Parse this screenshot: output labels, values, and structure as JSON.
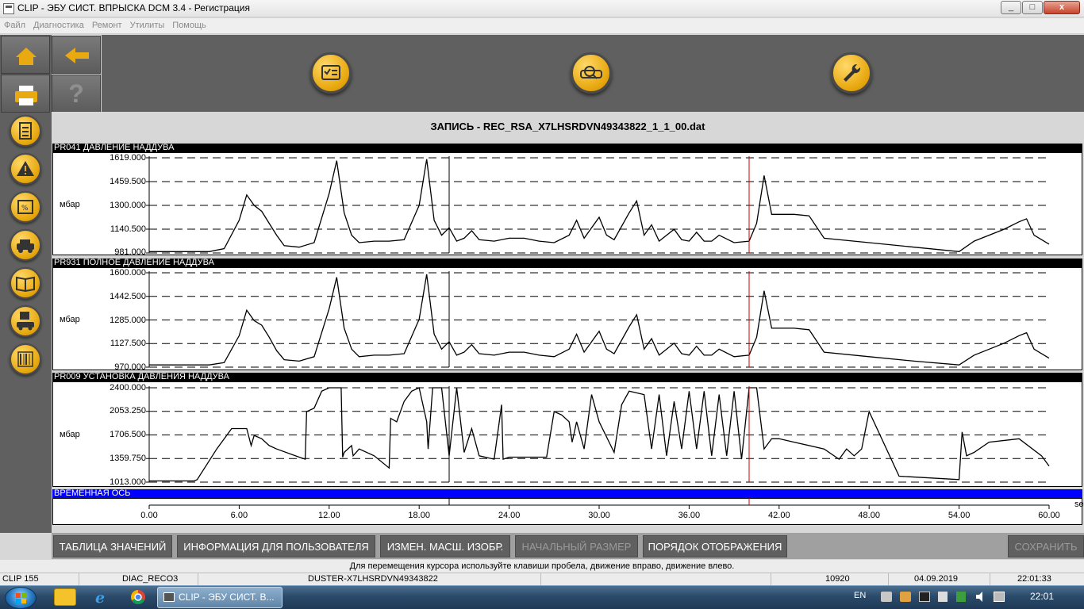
{
  "window": {
    "title": "CLIP - ЭБУ СИСТ. ВПРЫСКА DCM 3.4 - Регистрация",
    "min": "_",
    "max": "□",
    "close": "x"
  },
  "menu": [
    "Файл",
    "Диагностика",
    "Ремонт",
    "Утилиты",
    "Помощь"
  ],
  "left_nav": {
    "top_buttons": [
      {
        "icon": "home-icon"
      },
      {
        "icon": "back-arrow-icon"
      },
      {
        "icon": "printer-icon"
      },
      {
        "icon": "help-icon",
        "label": "?"
      }
    ],
    "round_buttons": [
      "document-list-icon",
      "warning-icon",
      "parameters-icon",
      "vehicle-icon",
      "manual-icon",
      "vehicle-save-icon",
      "barcode-icon"
    ]
  },
  "toolbar": {
    "buttons": [
      "checklist-icon",
      "vehicle-diagnostic-icon",
      "wrench-icon"
    ]
  },
  "recording": {
    "title": "ЗАПИСЬ - REC_RSA_X7LHSRDVN49343822_1_1_00.dat"
  },
  "colors": {
    "yellow": "#e8a911",
    "panel": "#606060",
    "cursor_red": "#cc0000",
    "time_bar": "#0000ff"
  },
  "charts": [
    {
      "header": "PR041  ДАВЛЕНИЕ НАДДУВА",
      "unit": "мбар",
      "y_ticks": [
        "1619.000",
        "1459.500",
        "1300.000",
        "1140.500",
        "981.000"
      ],
      "ylim": [
        981,
        1619
      ]
    },
    {
      "header": "PR931  ПОЛНОЕ ДАВЛЕНИЕ НАДДУВА",
      "unit": "мбар",
      "y_ticks": [
        "1600.000",
        "1442.500",
        "1285.000",
        "1127.500",
        "970.000"
      ],
      "ylim": [
        970,
        1600
      ]
    },
    {
      "header": "PR009  УСТАНОВКА ДАВЛЕНИЯ НАДДУВА",
      "unit": "мбар",
      "y_ticks": [
        "2400.000",
        "2053.250",
        "1706.500",
        "1359.750",
        "1013.000"
      ],
      "ylim": [
        1013,
        2400
      ]
    }
  ],
  "time_axis": {
    "header": "ВРЕМЕННАЯ ОСЬ",
    "unit": "se",
    "ticks": [
      "0.00",
      "6.00",
      "12.00",
      "18.00",
      "24.00",
      "30.00",
      "36.00",
      "42.00",
      "48.00",
      "54.00",
      "60.00"
    ],
    "xlim": [
      0,
      60
    ],
    "cursor_black": 20.0,
    "cursor_red": 40.0
  },
  "chart_data": [
    {
      "type": "line",
      "title": "PR041  ДАВЛЕНИЕ НАДДУВА",
      "ylabel": "мбар",
      "xlim": [
        0,
        60
      ],
      "ylim": [
        981,
        1619
      ],
      "grid": true,
      "x": [
        0,
        3,
        4,
        5,
        6,
        6.5,
        7,
        7.5,
        8,
        8.5,
        9,
        10,
        11,
        12,
        12.5,
        13,
        13.5,
        14,
        15,
        16,
        17,
        18,
        18.5,
        19,
        19.5,
        20,
        20.5,
        21,
        21.5,
        22,
        23,
        24,
        25,
        26,
        27,
        28,
        28.5,
        29,
        30,
        30.5,
        31,
        32,
        32.5,
        33,
        33.5,
        34,
        35,
        35.5,
        36,
        36.5,
        37,
        37.5,
        38,
        39,
        40,
        40.5,
        41,
        41.5,
        42,
        43,
        44,
        45,
        48,
        51,
        54,
        55,
        57,
        58,
        58.5,
        59,
        60
      ],
      "values": [
        990,
        990,
        990,
        1010,
        1200,
        1370,
        1300,
        1260,
        1180,
        1100,
        1030,
        1020,
        1050,
        1380,
        1600,
        1250,
        1100,
        1050,
        1060,
        1060,
        1070,
        1300,
        1610,
        1200,
        1100,
        1150,
        1060,
        1080,
        1130,
        1070,
        1060,
        1080,
        1080,
        1060,
        1050,
        1100,
        1200,
        1080,
        1220,
        1100,
        1070,
        1250,
        1330,
        1100,
        1170,
        1060,
        1140,
        1070,
        1060,
        1120,
        1060,
        1060,
        1100,
        1050,
        1060,
        1180,
        1500,
        1240,
        1240,
        1240,
        1230,
        1080,
        1050,
        1020,
        990,
        1060,
        1140,
        1190,
        1210,
        1100,
        1040
      ]
    },
    {
      "type": "line",
      "title": "PR931  ПОЛНОЕ ДАВЛЕНИЕ НАДДУВА",
      "ylabel": "мбар",
      "xlim": [
        0,
        60
      ],
      "ylim": [
        970,
        1600
      ],
      "grid": true,
      "x": [
        0,
        3,
        4,
        5,
        6,
        6.5,
        7,
        7.5,
        8,
        8.5,
        9,
        10,
        11,
        12,
        12.5,
        13,
        13.5,
        14,
        15,
        16,
        17,
        18,
        18.5,
        19,
        19.5,
        20,
        20.5,
        21,
        21.5,
        22,
        23,
        24,
        25,
        26,
        27,
        28,
        28.5,
        29,
        30,
        30.5,
        31,
        32,
        32.5,
        33,
        33.5,
        34,
        35,
        35.5,
        36,
        36.5,
        37,
        37.5,
        38,
        39,
        40,
        40.5,
        41,
        41.5,
        42,
        43,
        44,
        45,
        48,
        51,
        54,
        55,
        57,
        58,
        58.5,
        59,
        60
      ],
      "values": [
        985,
        985,
        985,
        1000,
        1180,
        1350,
        1280,
        1250,
        1170,
        1080,
        1020,
        1010,
        1040,
        1360,
        1570,
        1230,
        1090,
        1040,
        1050,
        1050,
        1060,
        1290,
        1590,
        1190,
        1090,
        1140,
        1050,
        1070,
        1120,
        1060,
        1050,
        1070,
        1070,
        1050,
        1040,
        1090,
        1190,
        1070,
        1210,
        1090,
        1060,
        1240,
        1320,
        1090,
        1160,
        1050,
        1130,
        1060,
        1050,
        1110,
        1050,
        1050,
        1090,
        1040,
        1050,
        1170,
        1480,
        1230,
        1230,
        1230,
        1220,
        1070,
        1040,
        1010,
        985,
        1050,
        1130,
        1180,
        1200,
        1090,
        1030
      ]
    },
    {
      "type": "line",
      "title": "PR009  УСТАНОВКА ДАВЛЕНИЯ НАДДУВА",
      "ylabel": "мбар",
      "xlim": [
        0,
        60
      ],
      "ylim": [
        1013,
        2400
      ],
      "grid": true,
      "x": [
        0,
        3,
        3.2,
        4.5,
        5.5,
        6.5,
        6.8,
        7,
        7.5,
        8,
        8.5,
        10,
        10.4,
        10.5,
        11,
        11.5,
        12,
        12.8,
        12.9,
        13,
        13.5,
        13.6,
        14,
        15,
        16,
        16.1,
        16.5,
        17,
        17.5,
        18,
        18.5,
        18.6,
        18.9,
        19.5,
        20,
        20.5,
        21,
        21.5,
        22,
        23,
        23.5,
        23.6,
        24,
        26.5,
        27,
        27.5,
        28,
        28.2,
        28.5,
        29,
        29.5,
        30,
        31,
        31.5,
        32,
        33,
        33.5,
        34,
        34.5,
        35,
        35.5,
        36,
        36.5,
        37,
        37.5,
        38,
        38.5,
        39,
        39.5,
        40,
        40.5,
        41,
        41.5,
        42,
        43,
        45,
        46,
        46.5,
        47,
        47.5,
        48,
        50,
        54,
        54.2,
        54.5,
        55,
        56,
        58,
        59.5,
        60
      ],
      "values": [
        1030,
        1030,
        1050,
        1500,
        1800,
        1800,
        1550,
        1700,
        1650,
        1550,
        1500,
        1380,
        1350,
        2050,
        2100,
        2350,
        2400,
        2400,
        1380,
        1450,
        1550,
        1400,
        1500,
        1400,
        1220,
        1950,
        1900,
        2200,
        2350,
        2400,
        1900,
        1500,
        2400,
        2400,
        1400,
        2400,
        1450,
        1800,
        1400,
        1350,
        2150,
        1350,
        1380,
        1380,
        2050,
        2000,
        1900,
        1600,
        1900,
        1500,
        2300,
        1900,
        1450,
        2150,
        2350,
        2300,
        1500,
        2300,
        1400,
        2200,
        1500,
        2350,
        1500,
        2350,
        1400,
        2300,
        1400,
        2350,
        1350,
        2400,
        2400,
        1500,
        1650,
        1650,
        1600,
        1500,
        1350,
        1500,
        1400,
        1500,
        2050,
        1100,
        1050,
        1750,
        1400,
        1450,
        1600,
        1650,
        1400,
        1250
      ]
    }
  ],
  "bottom_buttons": [
    {
      "label": "ТАБЛИЦА ЗНАЧЕНИЙ",
      "enabled": true
    },
    {
      "label": "ИНФОРМАЦИЯ ДЛЯ ПОЛЬЗОВАТЕЛЯ",
      "enabled": true
    },
    {
      "label": "ИЗМЕН. МАСШ. ИЗОБР.",
      "enabled": true
    },
    {
      "label": "НАЧАЛЬНЫЙ РАЗМЕР",
      "enabled": false
    },
    {
      "label": "ПОРЯДОК ОТОБРАЖЕНИЯ",
      "enabled": true
    },
    {
      "label": "СОХРАНИТЬ",
      "enabled": false
    }
  ],
  "hint": "Для перемещения курсора используйте клавиши пробела, движение вправо, движение влево.",
  "status": [
    "CLIP 155",
    "DIAC_RECO3",
    "DUSTER-X7LHSRDVN49343822",
    "",
    "10920",
    "04.09.2019",
    "22:01:33"
  ],
  "taskbar": {
    "active_window": "CLIP - ЭБУ СИСТ. В...",
    "lang": "EN",
    "clock": "22:01"
  }
}
